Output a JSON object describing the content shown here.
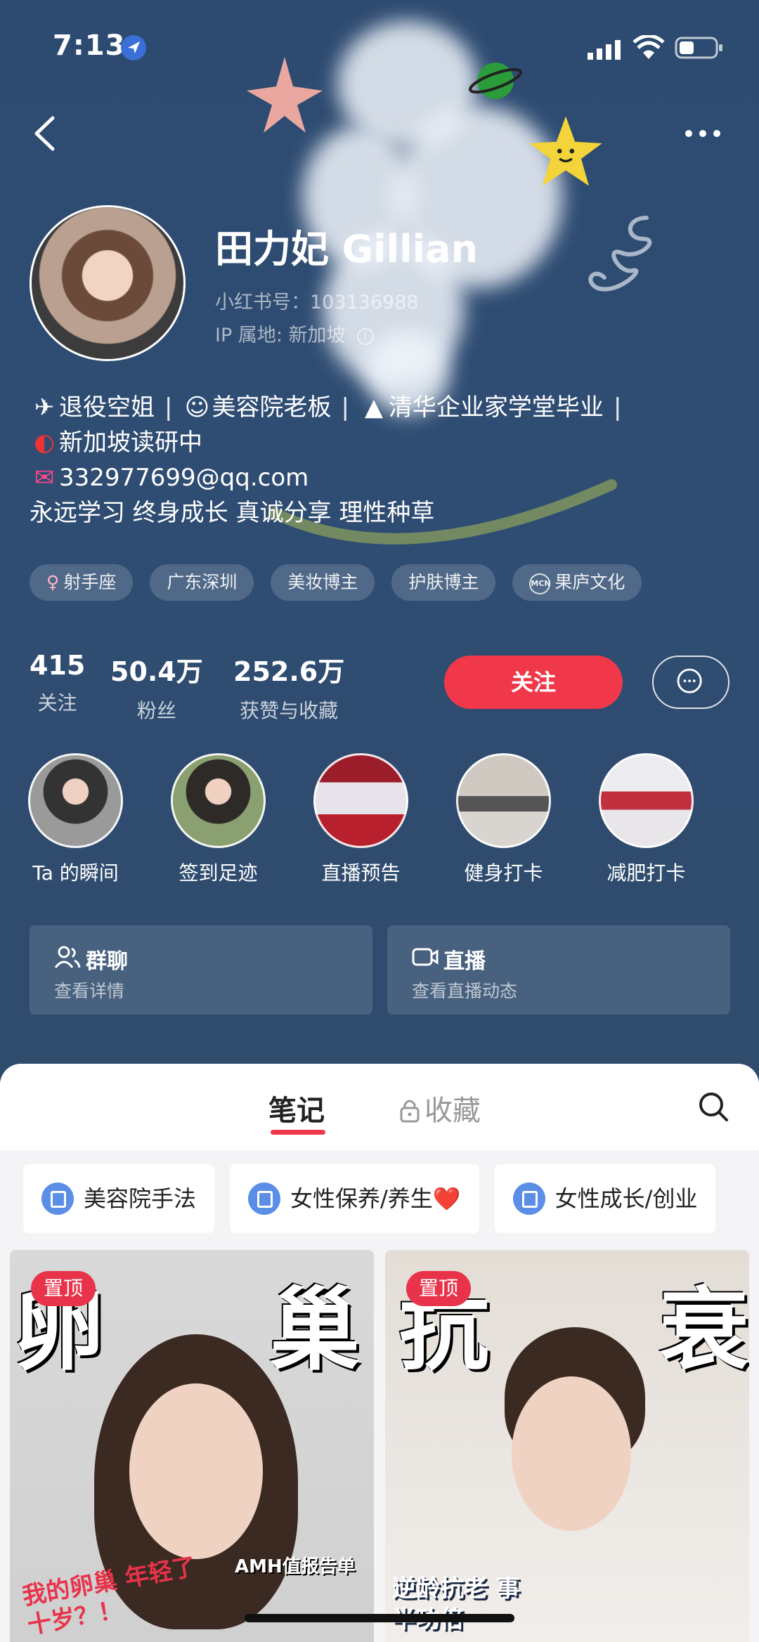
{
  "status_bar": {
    "time": "7:13"
  },
  "profile": {
    "name": "田力妃 Gillian",
    "redbook_id": "小红书号：103136988",
    "ip_location": "IP 属地: 新加坡",
    "bio": {
      "line1": [
        "退役空姐",
        "美容院老板",
        "清华企业家学堂毕业"
      ],
      "line2": "新加坡读研中",
      "line3": "332977699@qq.com",
      "line4": "永远学习 终身成长 真诚分享 理性种草"
    },
    "tags": [
      "射手座",
      "广东深圳",
      "美妆博主",
      "护肤博主",
      "果庐文化"
    ],
    "stats": [
      {
        "value": "415",
        "label": "关注"
      },
      {
        "value": "50.4万",
        "label": "粉丝"
      },
      {
        "value": "252.6万",
        "label": "获赞与收藏"
      }
    ],
    "follow_label": "关注"
  },
  "highlights": [
    "Ta 的瞬间",
    "签到足迹",
    "直播预告",
    "健身打卡",
    "减肥打卡"
  ],
  "cards": [
    {
      "title": "群聊",
      "subtitle": "查看详情"
    },
    {
      "title": "直播",
      "subtitle": "查看直播动态"
    }
  ],
  "tabs": {
    "notes": "笔记",
    "favorites": "收藏"
  },
  "chips": [
    "美容院手法",
    "女性保养/养生❤️",
    "女性成长/创业"
  ],
  "notes": [
    {
      "pin": "置顶",
      "title_left": "卵",
      "title_right": "巢",
      "caption": "我的卵巢 年轻了十岁？！",
      "tag": "AMH值报告单"
    },
    {
      "pin": "置顶",
      "title_left": "抗",
      "title_right": "衰",
      "caption": "逆龄抗老 事半功倍"
    }
  ],
  "colors": {
    "accent": "#f0384a",
    "header_bg": "#2f4c6e",
    "chip_icon": "#5b8ee6"
  }
}
